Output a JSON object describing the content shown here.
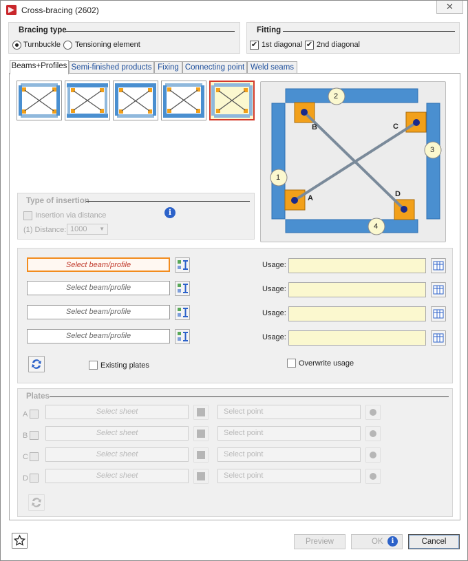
{
  "window": {
    "title": "Cross-bracing (2602)",
    "close": "✕"
  },
  "bracing_type": {
    "title": "Bracing type",
    "options": [
      {
        "label": "Turnbuckle",
        "selected": true
      },
      {
        "label": "Tensioning element",
        "selected": false
      }
    ]
  },
  "fitting": {
    "title": "Fitting",
    "options": [
      {
        "label": "1st diagonal",
        "checked": true
      },
      {
        "label": "2nd diagonal",
        "checked": true
      }
    ]
  },
  "tabs": [
    {
      "label": "Beams+Profiles",
      "active": true
    },
    {
      "label": "Semi-finished products",
      "active": false
    },
    {
      "label": "Fixing",
      "active": false
    },
    {
      "label": "Connecting point",
      "active": false
    },
    {
      "label": "Weld seams",
      "active": false
    }
  ],
  "type_of_insertion": {
    "title": "Type of insertion",
    "checkbox_label": "Insertion via distance",
    "distance_label": "(1) Distance:",
    "distance_value": "1000"
  },
  "diagram": {
    "beam_numbers": [
      "1",
      "2",
      "3",
      "4"
    ],
    "point_labels": [
      "A",
      "B",
      "C",
      "D"
    ]
  },
  "beams": {
    "rows": [
      {
        "placeholder": "Select beam/profile",
        "usage_label": "Usage:"
      },
      {
        "placeholder": "Select beam/profile",
        "usage_label": "Usage:"
      },
      {
        "placeholder": "Select beam/profile",
        "usage_label": "Usage:"
      },
      {
        "placeholder": "Select beam/profile",
        "usage_label": "Usage:"
      }
    ],
    "existing_plates_label": "Existing plates",
    "overwrite_usage_label": "Overwrite usage"
  },
  "plates": {
    "title": "Plates",
    "rows": [
      {
        "letter": "A",
        "sheet": "Select sheet",
        "point": "Select point"
      },
      {
        "letter": "B",
        "sheet": "Select sheet",
        "point": "Select point"
      },
      {
        "letter": "C",
        "sheet": "Select sheet",
        "point": "Select point"
      },
      {
        "letter": "D",
        "sheet": "Select sheet",
        "point": "Select point"
      }
    ]
  },
  "footer": {
    "preview": "Preview",
    "ok": "OK",
    "cancel": "Cancel"
  },
  "colors": {
    "accent_orange": "#f28c1e",
    "beam_blue": "#4a8fd0",
    "usage_yellow": "#fbf8cf",
    "selected_red": "#d43a2a"
  }
}
